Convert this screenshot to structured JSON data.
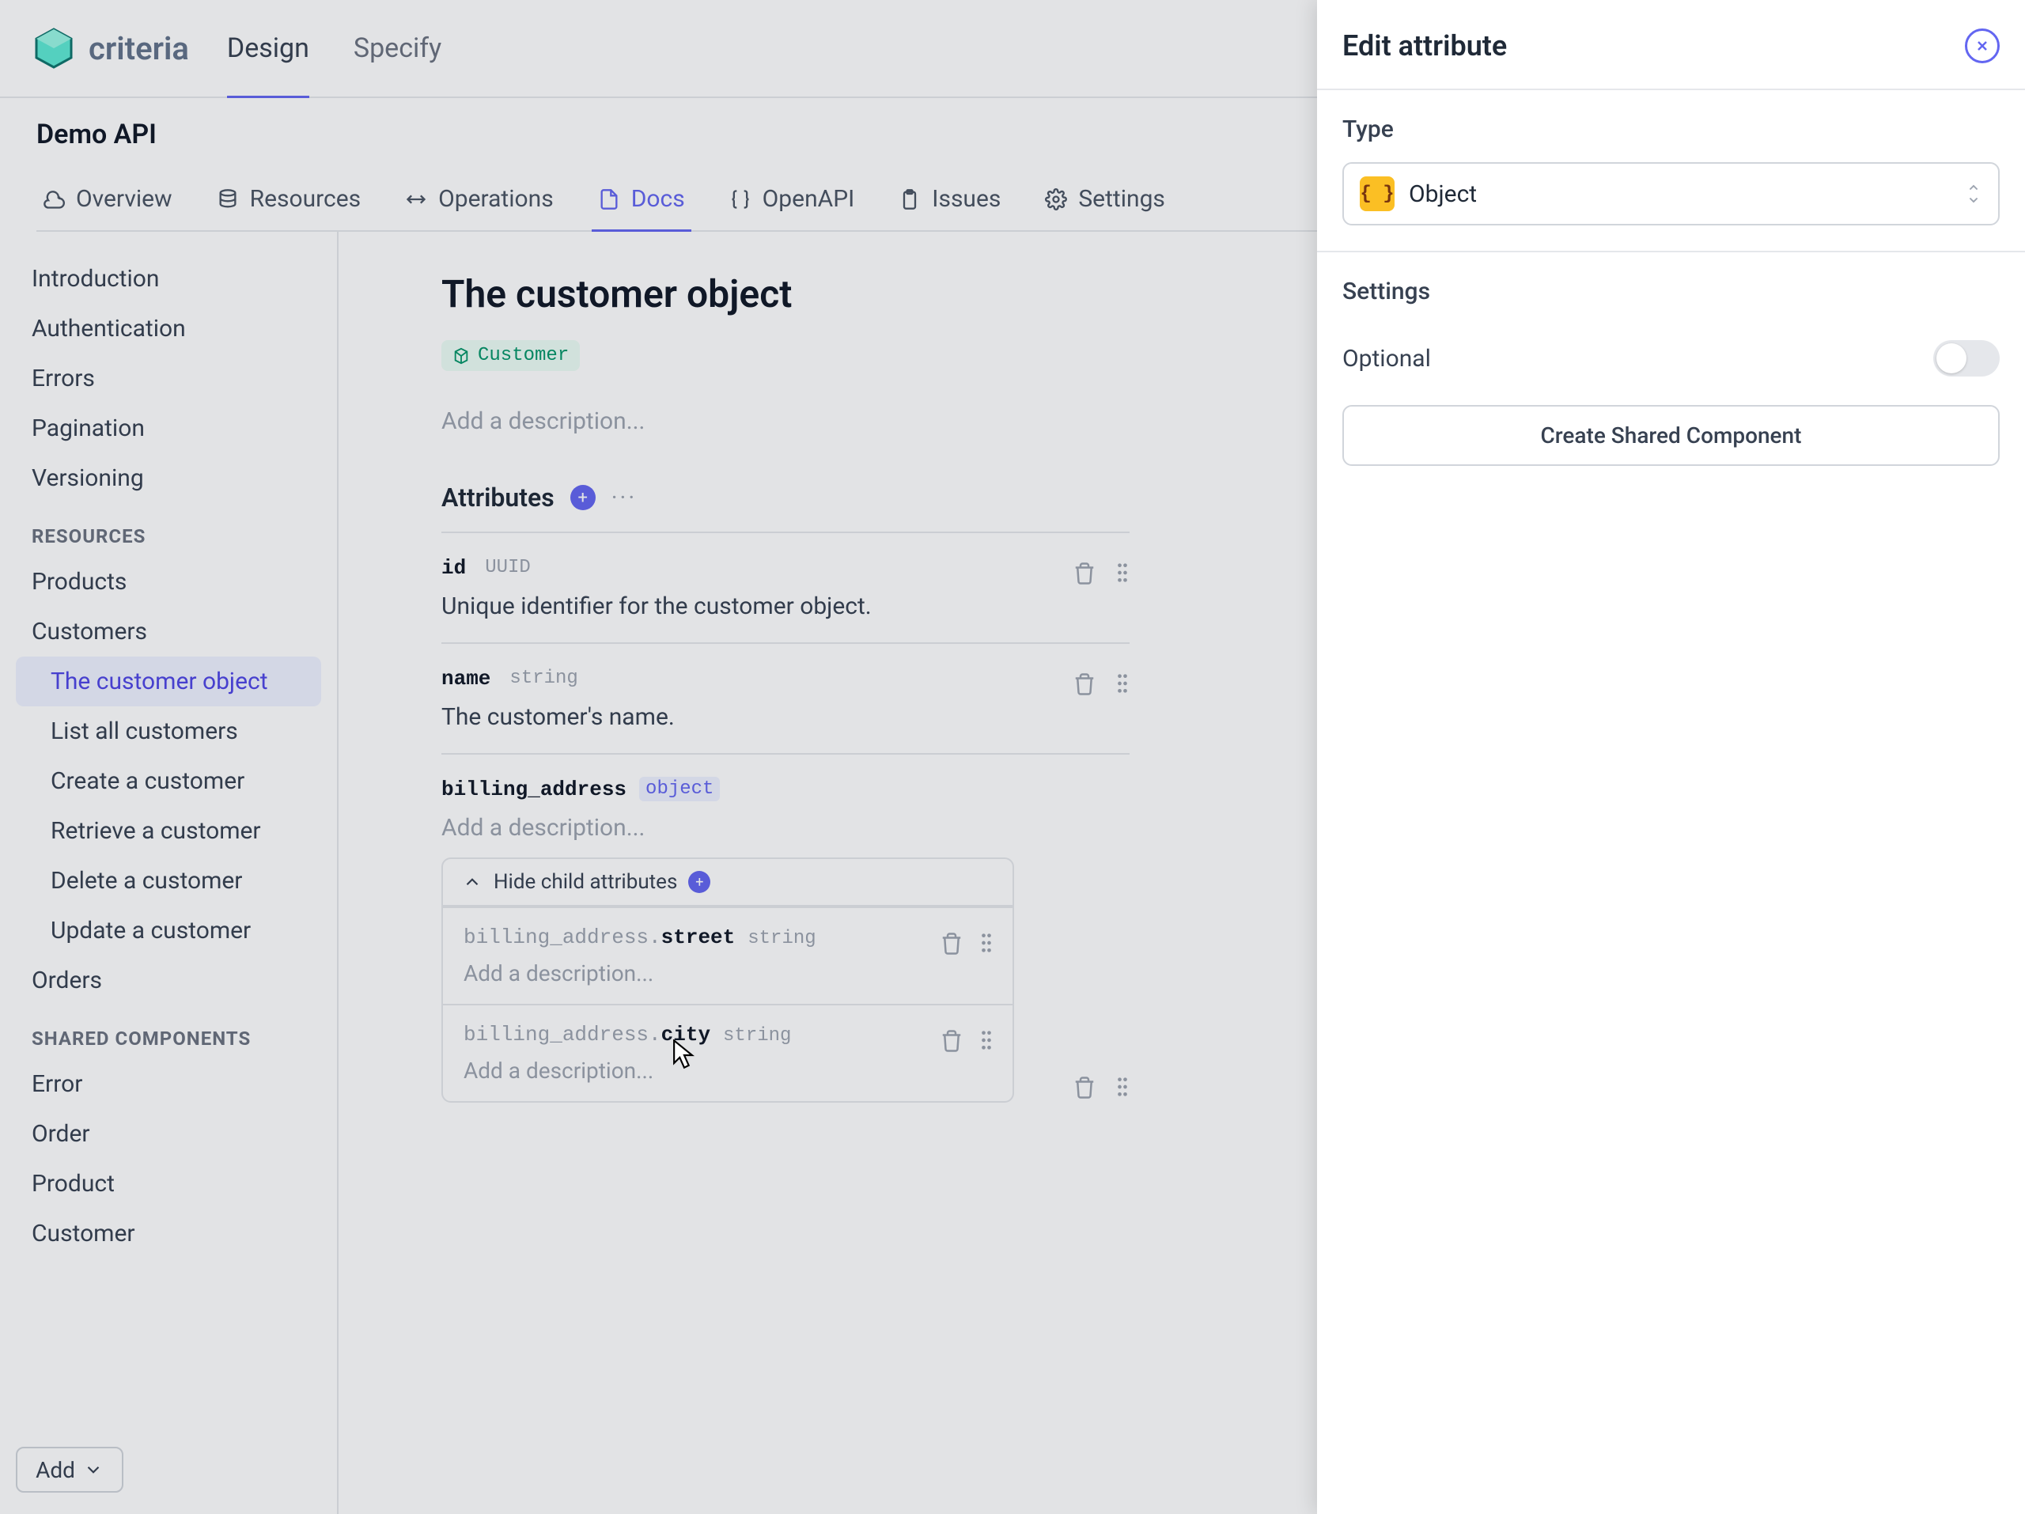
{
  "brand": "criteria",
  "topTabs": {
    "design": "Design",
    "specify": "Specify"
  },
  "apiTitle": "Demo API",
  "subtabs": {
    "overview": "Overview",
    "resources": "Resources",
    "operations": "Operations",
    "docs": "Docs",
    "openapi": "OpenAPI",
    "issues": "Issues",
    "settings": "Settings"
  },
  "sidebar": {
    "intro": "Introduction",
    "auth": "Authentication",
    "errors": "Errors",
    "pagination": "Pagination",
    "versioning": "Versioning",
    "resourcesHeading": "RESOURCES",
    "products": "Products",
    "customers": "Customers",
    "customerChildren": {
      "obj": "The customer object",
      "list": "List all customers",
      "create": "Create a customer",
      "retrieve": "Retrieve a customer",
      "delete": "Delete a customer",
      "update": "Update a customer"
    },
    "orders": "Orders",
    "sharedHeading": "SHARED COMPONENTS",
    "error": "Error",
    "order": "Order",
    "product": "Product",
    "customer": "Customer",
    "addBtn": "Add"
  },
  "page": {
    "title": "The customer object",
    "tag": "Customer",
    "descPlaceholder": "Add a description...",
    "attributesHeading": "Attributes",
    "attrs": {
      "id": {
        "key": "id",
        "type": "UUID",
        "desc": "Unique identifier for the customer object."
      },
      "name": {
        "key": "name",
        "type": "string",
        "desc": "The customer's name."
      },
      "billing": {
        "key": "billing_address",
        "type": "object",
        "descPlaceholder": "Add a description...",
        "toggleLabel": "Hide child attributes",
        "children": {
          "street": {
            "parent": "billing_address.",
            "key": "street",
            "type": "string",
            "descPlaceholder": "Add a description..."
          },
          "city": {
            "parent": "billing_address.",
            "key": "city",
            "type": "string",
            "descPlaceholder": "Add a description..."
          }
        }
      }
    }
  },
  "panel": {
    "title": "Edit attribute",
    "typeLabel": "Type",
    "typeValue": "Object",
    "typeIcon": "{ }",
    "settingsLabel": "Settings",
    "optionalLabel": "Optional",
    "createBtn": "Create Shared Component"
  }
}
